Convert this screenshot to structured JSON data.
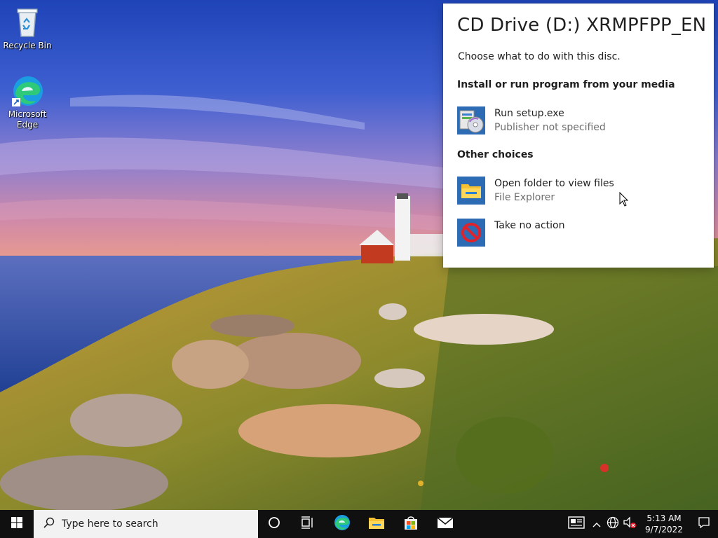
{
  "desktop": {
    "icons": [
      {
        "label": "Recycle Bin",
        "icon": "recycle-bin-icon"
      },
      {
        "label": "Microsoft Edge",
        "icon": "edge-icon"
      }
    ]
  },
  "autoplay": {
    "title": "CD Drive (D:) XRMPFPP_EN",
    "subtitle": "Choose what to do with this disc.",
    "section_install": "Install or run program from your media",
    "section_other": "Other choices",
    "options": [
      {
        "line1": "Run setup.exe",
        "line2": "Publisher not specified",
        "icon": "setup-installer-icon"
      },
      {
        "line1": "Open folder to view files",
        "line2": "File Explorer",
        "icon": "file-explorer-folder-icon"
      },
      {
        "line1": "Take no action",
        "line2": "",
        "icon": "no-action-icon"
      }
    ]
  },
  "taskbar": {
    "search_placeholder": "Type here to search",
    "apps": [
      "cortana-icon",
      "task-view-icon",
      "edge-icon",
      "file-explorer-icon",
      "store-icon",
      "mail-icon"
    ],
    "tray_icons": [
      "news-widget-icon",
      "chevron-up-icon",
      "network-icon",
      "volume-muted-icon"
    ],
    "time": "5:13 AM",
    "date": "9/7/2022",
    "colors": {
      "taskbar_bg": "#101010",
      "search_bg": "#f2f2f2",
      "accent": "#0078d7"
    }
  }
}
